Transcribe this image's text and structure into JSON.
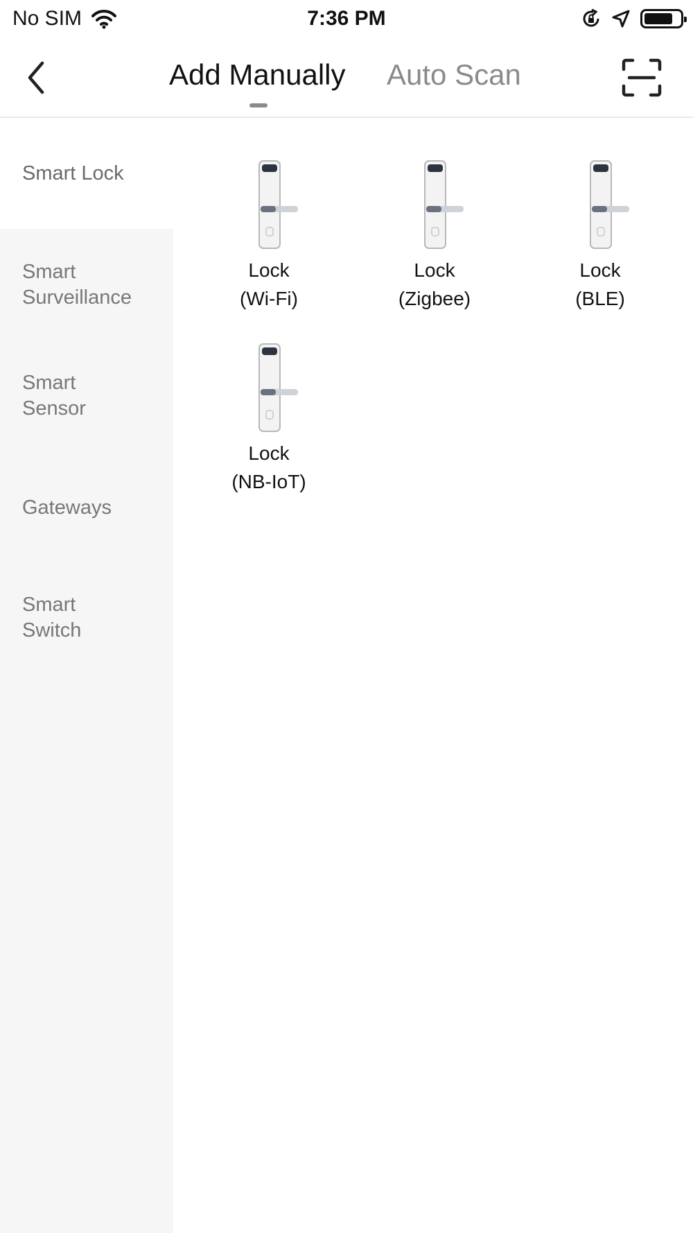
{
  "status_bar": {
    "carrier": "No SIM",
    "time": "7:36 PM",
    "icons": [
      "wifi-icon",
      "orientation-lock-icon",
      "location-arrow-icon",
      "battery-icon"
    ],
    "battery_level": 0.8
  },
  "nav": {
    "back_icon": "chevron-left-icon",
    "tabs": [
      {
        "label": "Add Manually",
        "active": true
      },
      {
        "label": "Auto Scan",
        "active": false
      }
    ],
    "scan_icon": "qr-scan-icon"
  },
  "sidebar": {
    "items": [
      {
        "line1": "Smart Lock",
        "line2": "",
        "active": true
      },
      {
        "line1": "Smart",
        "line2": "Surveillance",
        "active": false
      },
      {
        "line1": "Smart",
        "line2": "Sensor",
        "active": false
      },
      {
        "line1": "Gateways",
        "line2": "",
        "active": false
      },
      {
        "line1": "Smart",
        "line2": "Switch",
        "active": false
      }
    ]
  },
  "devices": [
    {
      "line1": "Lock",
      "line2": "(Wi-Fi)",
      "icon": "door-lock-icon"
    },
    {
      "line1": "Lock",
      "line2": "(Zigbee)",
      "icon": "door-lock-icon"
    },
    {
      "line1": "Lock",
      "line2": "(BLE)",
      "icon": "door-lock-icon"
    },
    {
      "line1": "Lock",
      "line2": "(NB-IoT)",
      "icon": "door-lock-icon"
    }
  ],
  "colors": {
    "sidebar_bg": "#f6f6f6",
    "active_text": "#111111",
    "inactive_text": "#8a8a8a"
  }
}
